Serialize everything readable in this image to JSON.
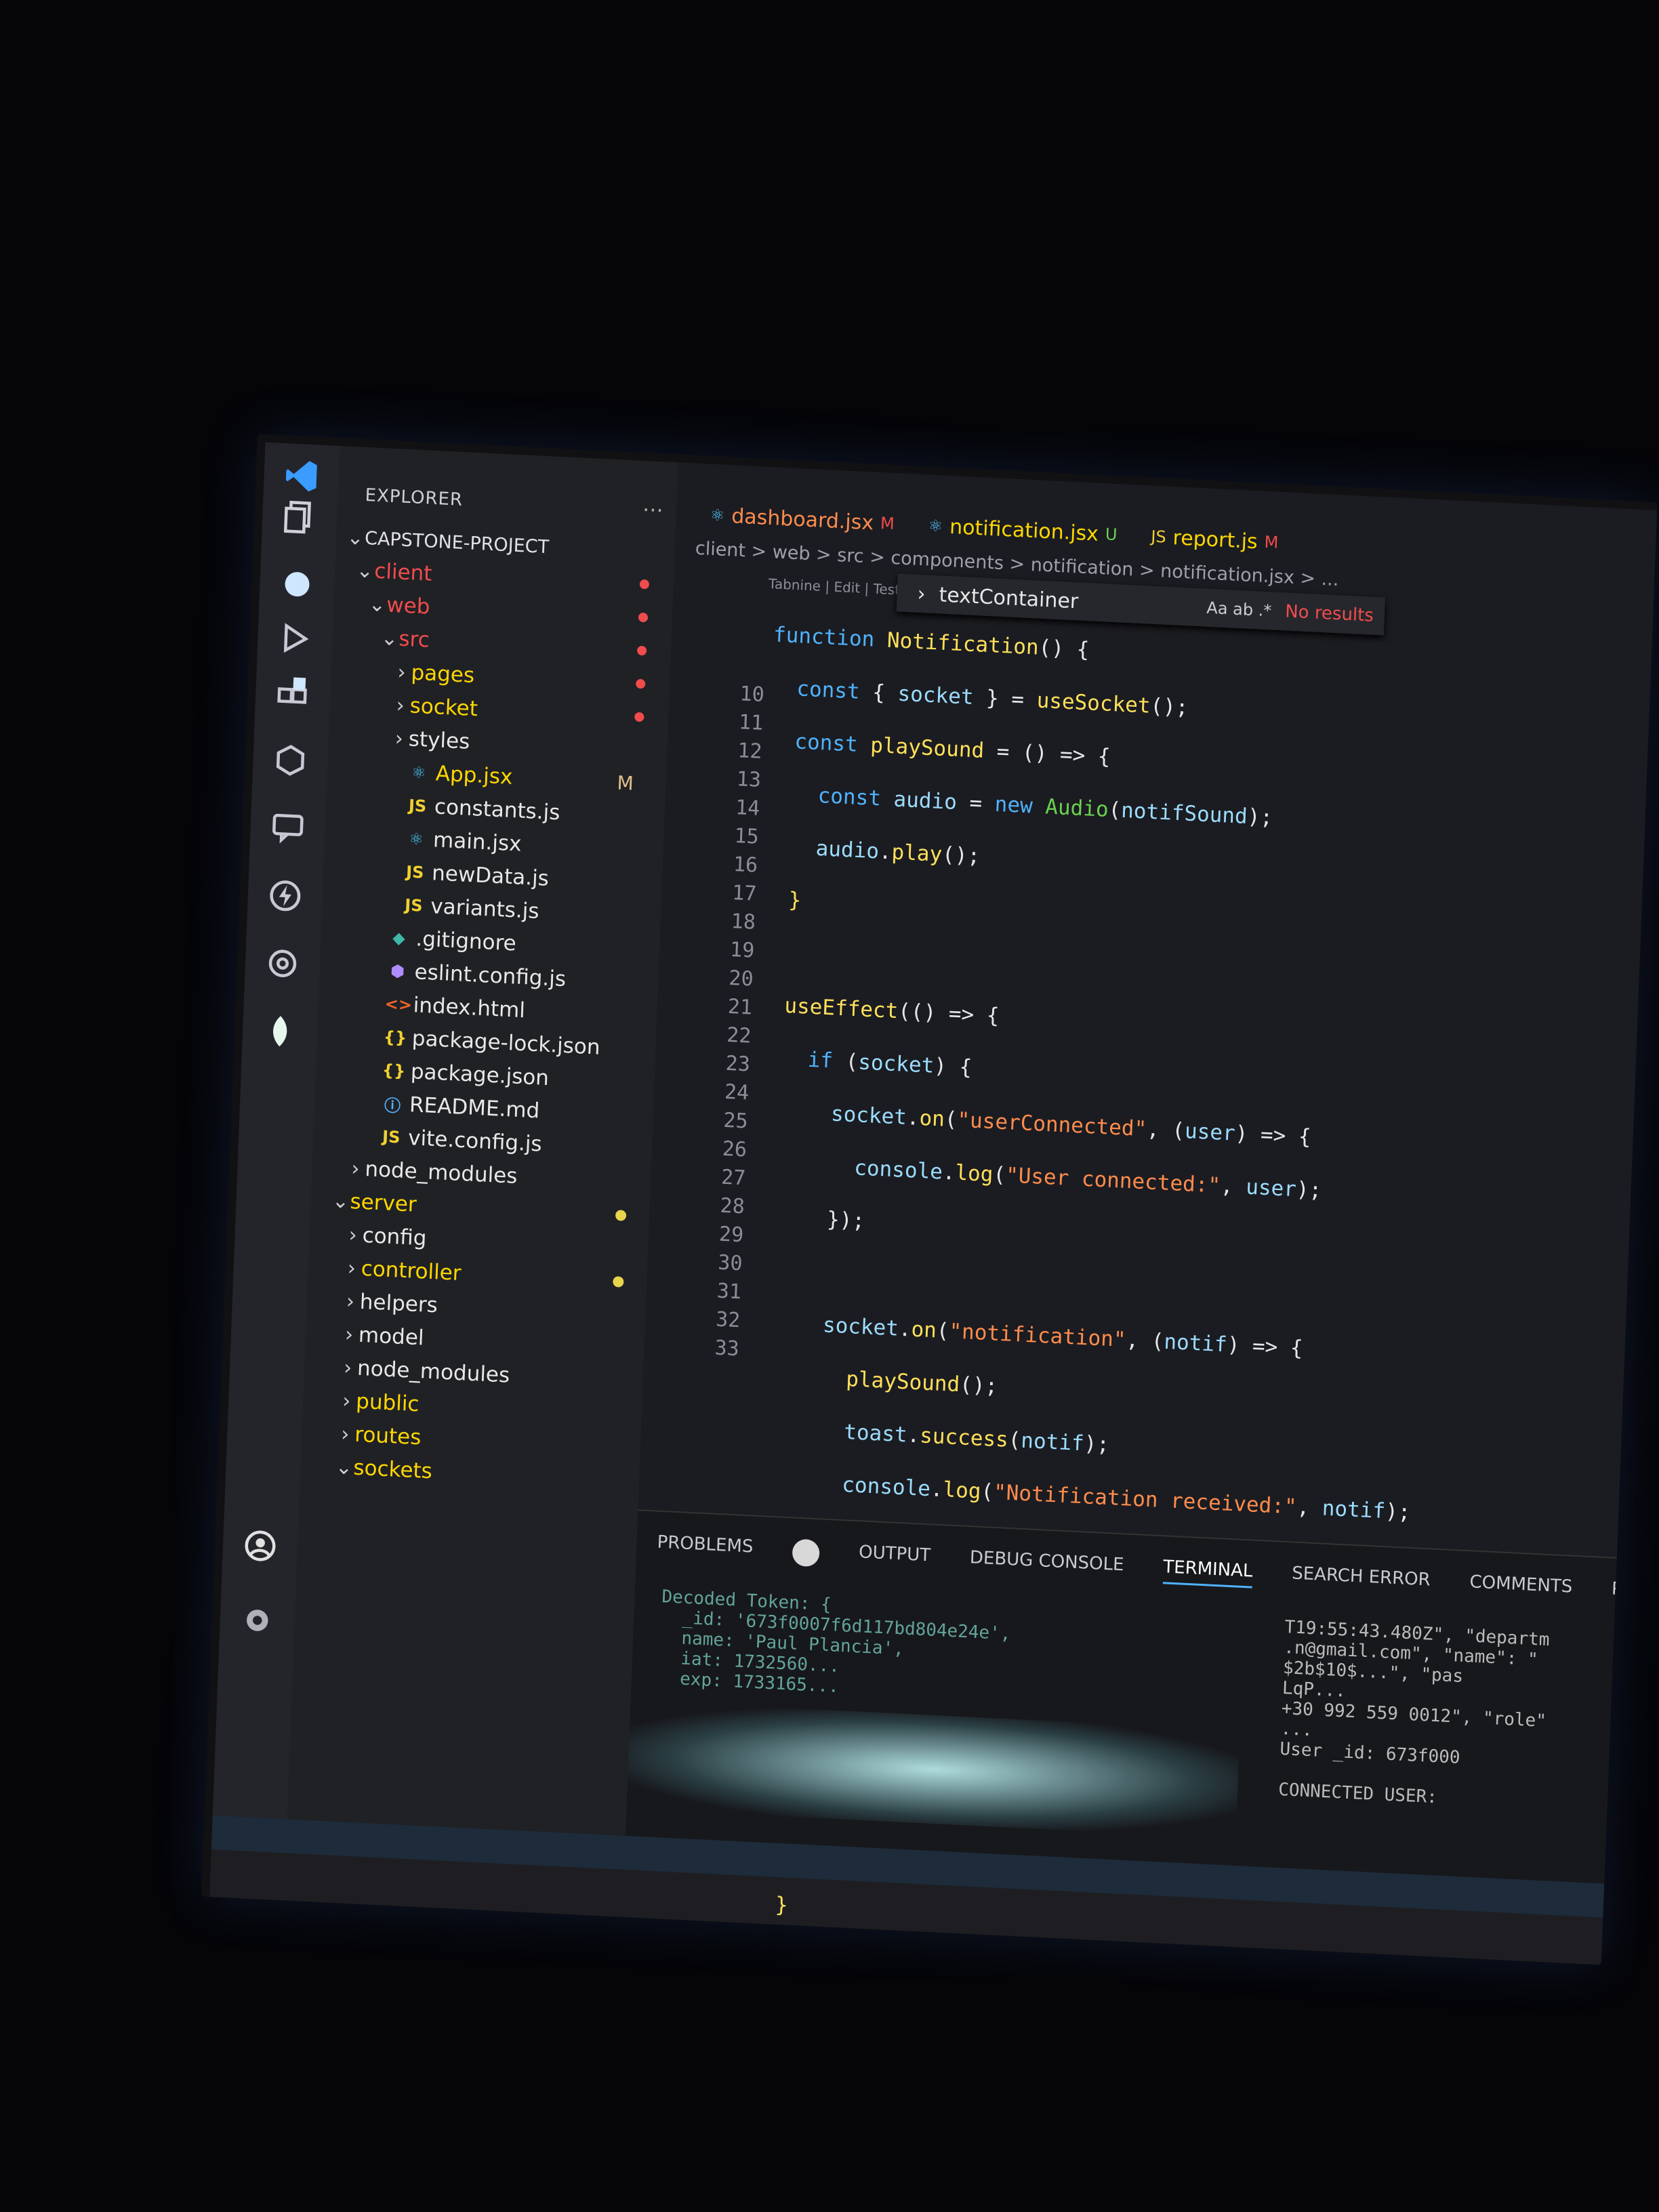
{
  "explorer": {
    "title": "EXPLORER",
    "more": "...",
    "project": "CAPSTONE-PROJECT",
    "tree": [
      {
        "label": "client",
        "kind": "folder-open",
        "depth": 0,
        "color": "#f14c4c",
        "dot": "red"
      },
      {
        "label": "web",
        "kind": "folder-open",
        "depth": 1,
        "color": "#f14c4c",
        "dot": "red"
      },
      {
        "label": "src",
        "kind": "folder-open",
        "depth": 2,
        "color": "#f14c4c",
        "dot": "red"
      },
      {
        "label": "pages",
        "kind": "folder",
        "depth": 3,
        "color": "#ffd700",
        "dot": "red"
      },
      {
        "label": "socket",
        "kind": "folder",
        "depth": 3,
        "color": "#ffd700",
        "dot": "red"
      },
      {
        "label": "styles",
        "kind": "folder",
        "depth": 3,
        "color": "#e8e8e8"
      },
      {
        "label": "App.jsx",
        "kind": "react",
        "depth": 3,
        "color": "#ffd700",
        "badge": "M"
      },
      {
        "label": "constants.js",
        "kind": "js",
        "depth": 3,
        "color": "#e8e8e8"
      },
      {
        "label": "main.jsx",
        "kind": "react",
        "depth": 3,
        "color": "#e8e8e8"
      },
      {
        "label": "newData.js",
        "kind": "js",
        "depth": 3,
        "color": "#e8e8e8"
      },
      {
        "label": "variants.js",
        "kind": "js",
        "depth": 3,
        "color": "#e8e8e8"
      },
      {
        "label": ".gitignore",
        "kind": "git",
        "depth": 2,
        "color": "#e8e8e8"
      },
      {
        "label": "eslint.config.js",
        "kind": "eslint",
        "depth": 2,
        "color": "#e8e8e8"
      },
      {
        "label": "index.html",
        "kind": "html",
        "depth": 2,
        "color": "#e8e8e8"
      },
      {
        "label": "package-lock.json",
        "kind": "json",
        "depth": 2,
        "color": "#e8e8e8"
      },
      {
        "label": "package.json",
        "kind": "json",
        "depth": 2,
        "color": "#e8e8e8"
      },
      {
        "label": "README.md",
        "kind": "info",
        "depth": 2,
        "color": "#e8e8e8"
      },
      {
        "label": "vite.config.js",
        "kind": "js",
        "depth": 2,
        "color": "#e8e8e8"
      },
      {
        "label": "node_modules",
        "kind": "folder",
        "depth": 1,
        "color": "#e8e8e8"
      },
      {
        "label": "server",
        "kind": "folder-open",
        "depth": 0,
        "color": "#ffd700",
        "dot": "yellow"
      },
      {
        "label": "config",
        "kind": "folder",
        "depth": 1,
        "color": "#e8e8e8"
      },
      {
        "label": "controller",
        "kind": "folder",
        "depth": 1,
        "color": "#ffd700",
        "dot": "yellow"
      },
      {
        "label": "helpers",
        "kind": "folder",
        "depth": 1,
        "color": "#e8e8e8"
      },
      {
        "label": "model",
        "kind": "folder",
        "depth": 1,
        "color": "#e8e8e8"
      },
      {
        "label": "node_modules",
        "kind": "folder",
        "depth": 1,
        "color": "#e8e8e8"
      },
      {
        "label": "public",
        "kind": "folder",
        "depth": 1,
        "color": "#ffd700"
      },
      {
        "label": "routes",
        "kind": "folder",
        "depth": 1,
        "color": "#ffd700"
      },
      {
        "label": "sockets",
        "kind": "folder-open",
        "depth": 1,
        "color": "#ffd700"
      }
    ]
  },
  "tabs": [
    {
      "label": "dashboard.jsx",
      "status": "M",
      "color": "#ff8c4c",
      "statusColor": "#f14c4c",
      "icon": "react-icon"
    },
    {
      "label": "notification.jsx",
      "status": "U",
      "color": "#ffd700",
      "statusColor": "#6ad14f",
      "icon": "react-icon"
    },
    {
      "label": "report.js",
      "status": "M",
      "color": "#ffd700",
      "statusColor": "#f14c4c",
      "icon": "js-icon"
    }
  ],
  "breadcrumb": "client > web > src > components > notification > notification.jsx > ...",
  "codelens": "Tabnine | Edit | Test | Explain |",
  "find": {
    "query": "textContainer",
    "options": "Aa  ab  .*",
    "result": "No results"
  },
  "line_numbers": [
    "10",
    "11",
    "12",
    "13",
    "14",
    "15",
    "16",
    "17",
    "18",
    "19",
    "20",
    "21",
    "22",
    "23",
    "24",
    "25",
    "26",
    "27",
    "28",
    "29",
    "30",
    "31",
    "32",
    "33"
  ],
  "panel": {
    "tabs": [
      "PROBLEMS",
      "OUTPUT",
      "DEBUG CONSOLE",
      "TERMINAL",
      "SEARCH ERROR",
      "COMMENTS",
      "PORTS"
    ],
    "active_tab": "TERMINAL",
    "terminal_left": "Decoded Token: {\n  _id: '673f0007f6d117bd804e24e',\n  name: 'Paul Plancia',\n  iat: 1732560...\n  exp: 1733165...",
    "terminal_right": "T19:55:43.480Z\", \"departm\n.n@gmail.com\", \"name\": \"\n$2b$10$...\", \"pas\nLqP...\n+30 992 559 0012\", \"role\"\n...\nUser _id: 673f000\n\nCONNECTED USER:"
  }
}
